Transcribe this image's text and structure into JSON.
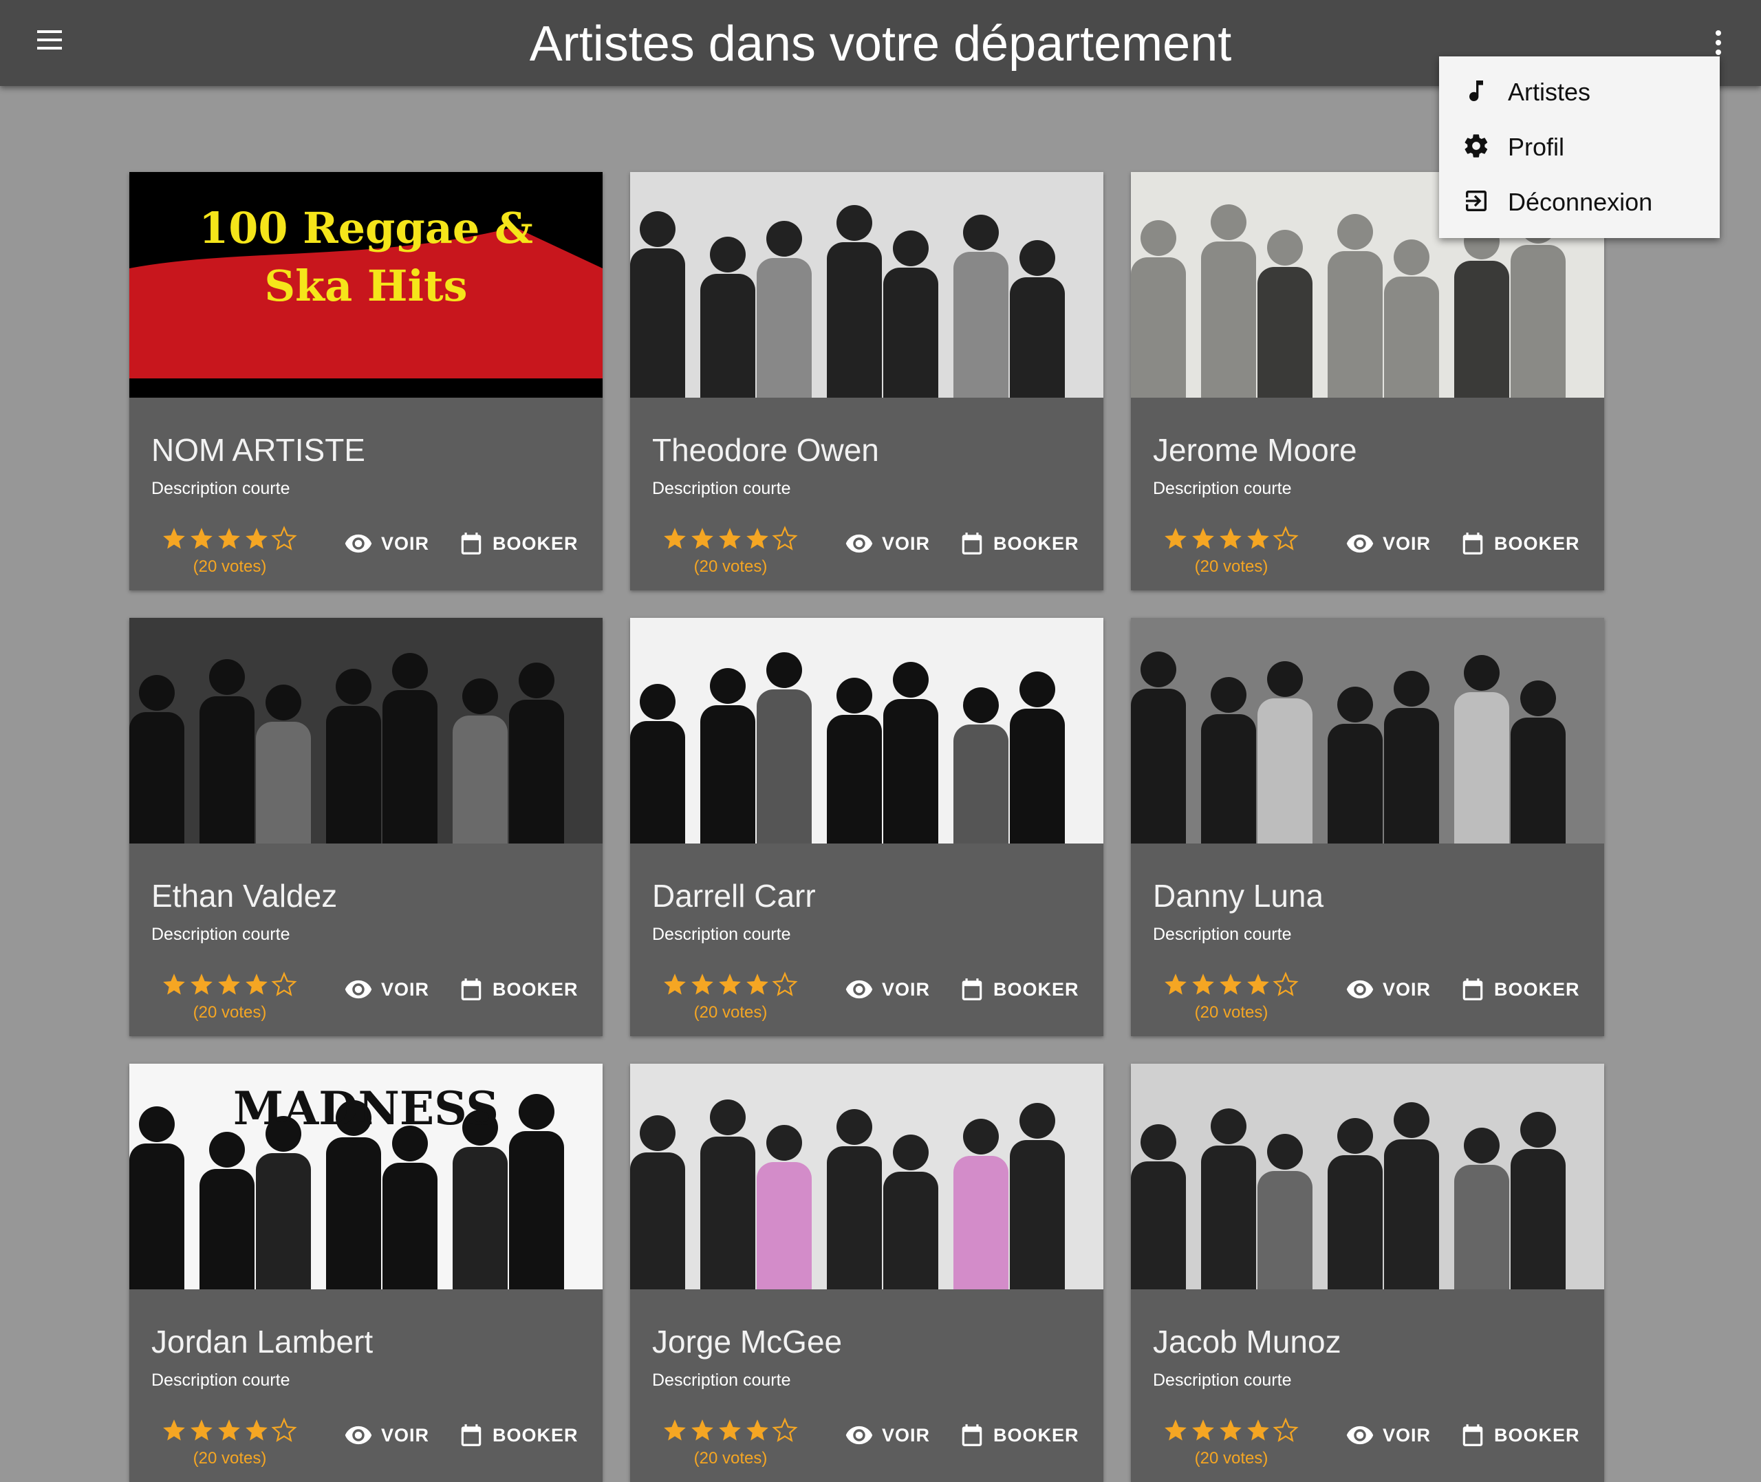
{
  "appbar": {
    "title": "Artistes dans votre département",
    "menu_icon": "hamburger-menu-icon",
    "more_icon": "more-vertical-icon"
  },
  "menu": {
    "items": [
      {
        "label": "Artistes",
        "icon": "music-note-icon"
      },
      {
        "label": "Profil",
        "icon": "gear-icon"
      },
      {
        "label": "Déconnexion",
        "icon": "logout-icon"
      }
    ]
  },
  "rating_color": "#f5a623",
  "cards": [
    {
      "name": "NOM ARTISTE",
      "description": "Description courte",
      "rating": 4,
      "votes": "(20 votes)",
      "voir": "VOIR",
      "booker": "BOOKER",
      "photo_caption": "100 Reggae & Ska Hits"
    },
    {
      "name": "Theodore Owen",
      "description": "Description courte",
      "rating": 4,
      "votes": "(20 votes)",
      "voir": "VOIR",
      "booker": "BOOKER"
    },
    {
      "name": "Jerome Moore",
      "description": "Description courte",
      "rating": 4,
      "votes": "(20 votes)",
      "voir": "VOIR",
      "booker": "BOOKER"
    },
    {
      "name": "Ethan Valdez",
      "description": "Description courte",
      "rating": 4,
      "votes": "(20 votes)",
      "voir": "VOIR",
      "booker": "BOOKER"
    },
    {
      "name": "Darrell Carr",
      "description": "Description courte",
      "rating": 4,
      "votes": "(20 votes)",
      "voir": "VOIR",
      "booker": "BOOKER"
    },
    {
      "name": "Danny Luna",
      "description": "Description courte",
      "rating": 4,
      "votes": "(20 votes)",
      "voir": "VOIR",
      "booker": "BOOKER"
    },
    {
      "name": "Jordan Lambert",
      "description": "Description courte",
      "rating": 4,
      "votes": "(20 votes)",
      "voir": "VOIR",
      "booker": "BOOKER",
      "photo_caption": "MADNESS"
    },
    {
      "name": "Jorge McGee",
      "description": "Description courte",
      "rating": 4,
      "votes": "(20 votes)",
      "voir": "VOIR",
      "booker": "BOOKER"
    },
    {
      "name": "Jacob Munoz",
      "description": "Description courte",
      "rating": 4,
      "votes": "(20 votes)",
      "voir": "VOIR",
      "booker": "BOOKER"
    }
  ]
}
